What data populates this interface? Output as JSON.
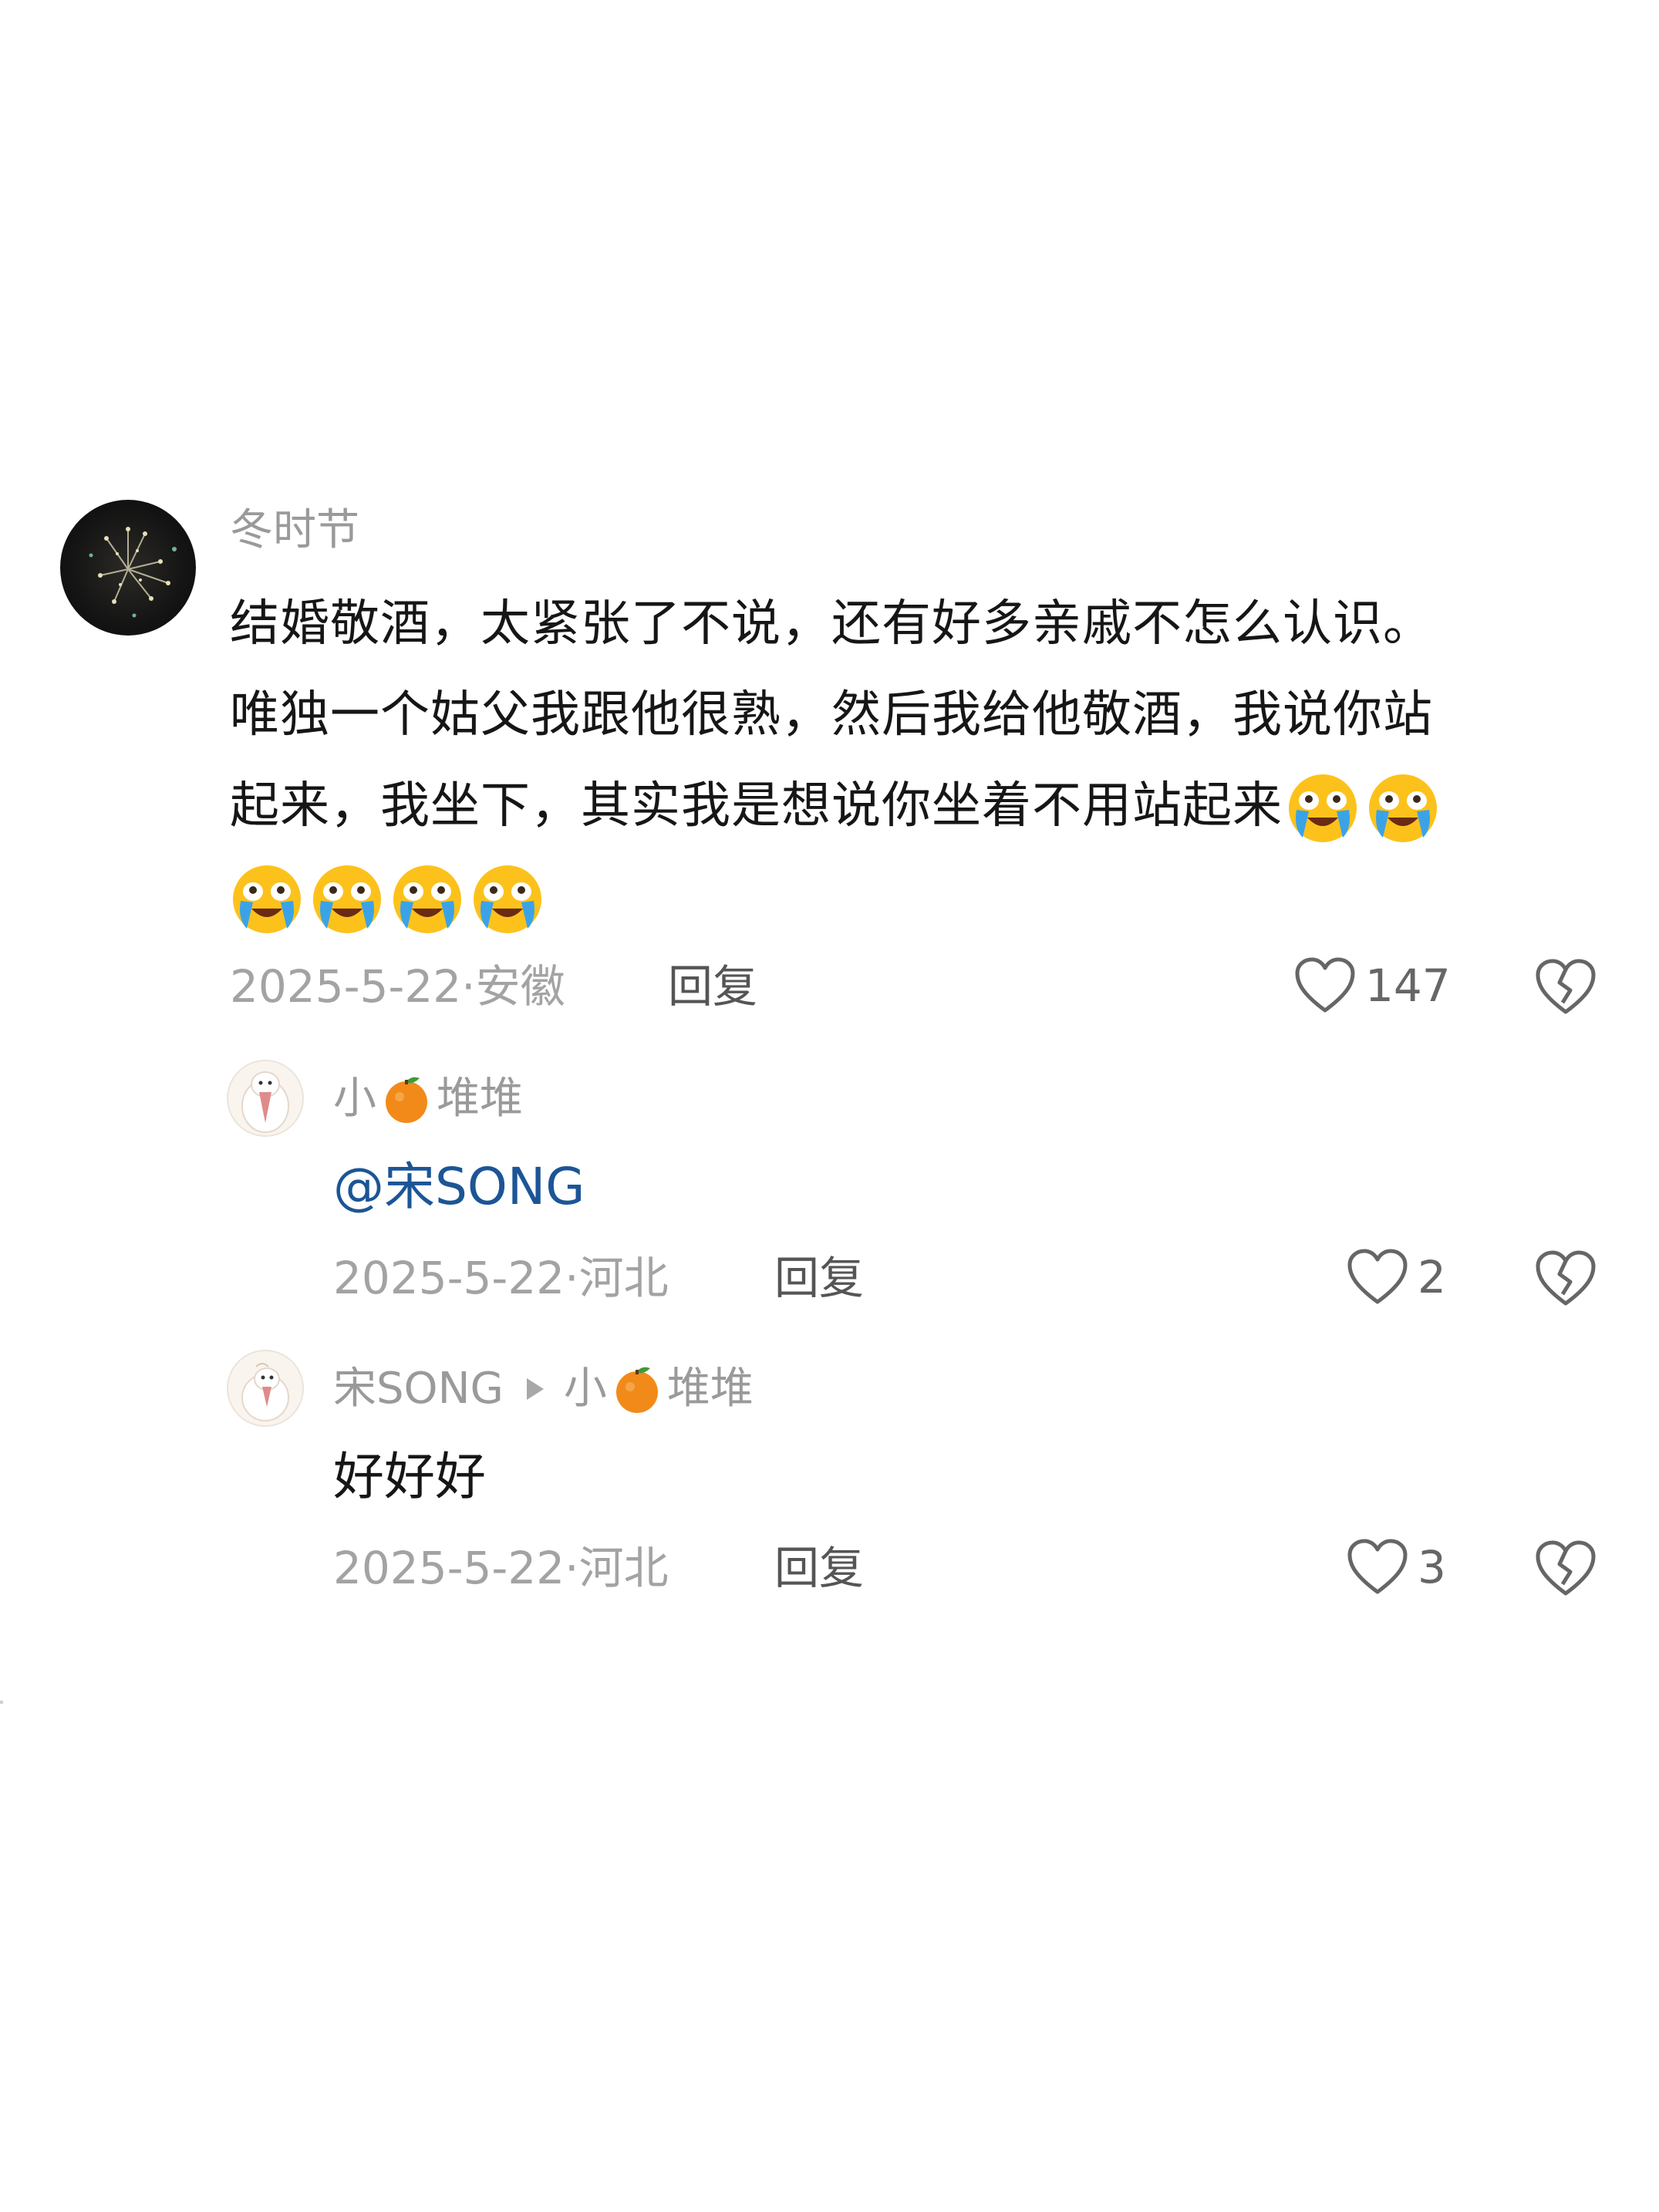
{
  "comment": {
    "username": "冬时节",
    "lines": [
      "结婚敬酒，太紧张了不说，还有好多亲戚不怎么认识。",
      "唯独一个姑父我跟他很熟，然后我给他敬酒，我说你站",
      "起来，我坐下，其实我是想说你坐着不用站起来"
    ],
    "date": "2025-5-22",
    "location": "安徽",
    "reply_label": "回复",
    "likes": "147",
    "emoji_icon": "loudly-crying-face-icon"
  },
  "replies": [
    {
      "username_a": "小",
      "username_b": "堆堆",
      "text": "@宋SONG",
      "date": "2025-5-22",
      "location": "河北",
      "reply_label": "回复",
      "likes": "2"
    },
    {
      "username": "宋SONG",
      "target_a": "小",
      "target_b": "堆堆",
      "text": "好好好",
      "date": "2025-5-22",
      "location": "河北",
      "reply_label": "回复",
      "likes": "3"
    }
  ],
  "icons": {
    "like": "heart-outline-icon",
    "dislike": "broken-heart-icon",
    "name_emoji": "tangerine-icon"
  },
  "colors": {
    "mention": "#1c5596",
    "muted": "#a3a3a3",
    "body": "#161616"
  }
}
